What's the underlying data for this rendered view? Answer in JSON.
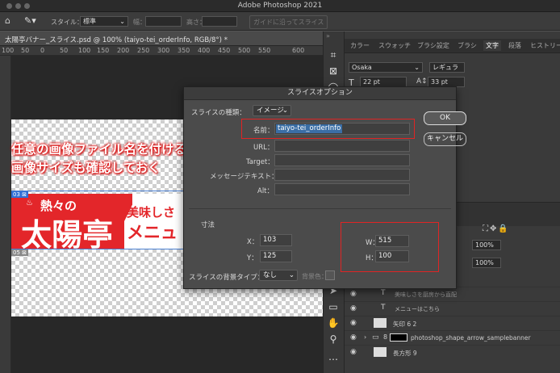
{
  "app_title": "Adobe Photoshop 2021",
  "options": {
    "style_label": "スタイル：",
    "style_value": "標準",
    "width_label": "幅：",
    "height_label": "高さ：",
    "guide_button": "ガイドに沿ってスライス"
  },
  "doc_tab": "太陽亭バナー_スライス.psd @ 100% (taiyo-tei_orderInfo, RGB/8°) *",
  "ruler": [
    "100",
    "50",
    "0",
    "50",
    "100",
    "150",
    "200",
    "250",
    "300",
    "350",
    "400",
    "450",
    "500",
    "550",
    "600"
  ],
  "canvas": {
    "annotation_line1": "任意の画像ファイル名を付ける。",
    "annotation_line2": "画像サイズも確認しておく",
    "slice_badge_top": "03 ⊠",
    "slice_badge_bottom": "05 ⊠",
    "banner_small": "熱々の",
    "banner_big": "太陽亭",
    "banner_right1": "美味しさ",
    "banner_right2": "メニュ"
  },
  "panel": {
    "tabs": [
      "カラー",
      "スウォッチ",
      "ブラシ設定",
      "ブラシ",
      "文字",
      "段落",
      "ヒストリー"
    ],
    "font": "Osaka",
    "style": "レギュラー",
    "size": "22 pt",
    "leading": "33 pt",
    "pct1": "100%",
    "pct2": "100%",
    "layers": [
      "美味しさを厨房から直配",
      "メニューはこちら",
      "矢印 6 2",
      "photoshop_shape_arrow_samplebanner",
      "長方形 9"
    ]
  },
  "dialog": {
    "title": "スライスオプション",
    "type_label": "スライスの種類：",
    "type_value": "イメージ",
    "name_label": "名前：",
    "name_value": "taiyo-tei_orderInfo",
    "url_label": "URL：",
    "target_label": "Target：",
    "message_label": "メッセージテキスト：",
    "alt_label": "Alt：",
    "ok": "OK",
    "cancel": "キャンセル",
    "dim_label": "寸法",
    "x_label": "X：",
    "x_value": "103",
    "y_label": "Y：",
    "y_value": "125",
    "w_label": "W：",
    "w_value": "515",
    "h_label": "H：",
    "h_value": "100",
    "bg_label": "スライスの背景タイプ：",
    "bg_value": "なし",
    "bg_color_label": "背景色："
  },
  "colors": {
    "accent_red": "#e02424",
    "banner_red": "#e3262a",
    "selection_blue": "#3b6ea5"
  }
}
